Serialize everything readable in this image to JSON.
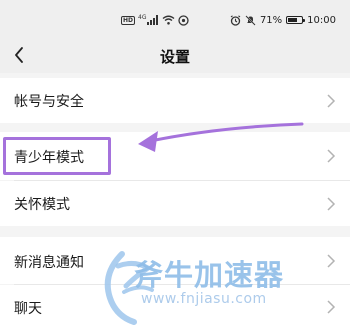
{
  "status_bar": {
    "hd_badge": "HD",
    "signal_text": "4G",
    "battery_text": "71%",
    "battery_level": 0.71,
    "time": "10:00"
  },
  "nav": {
    "title": "设置"
  },
  "settings": {
    "account_security": "帐号与安全",
    "youth_mode": "青少年模式",
    "care_mode": "关怀模式",
    "new_message_notice": "新消息通知",
    "chat": "聊天"
  },
  "watermark": {
    "brand": "斧牛加速器",
    "url": "www.fnjiasu.com"
  },
  "colors": {
    "highlight": "#a572dc",
    "watermark": "#8fbde8"
  }
}
